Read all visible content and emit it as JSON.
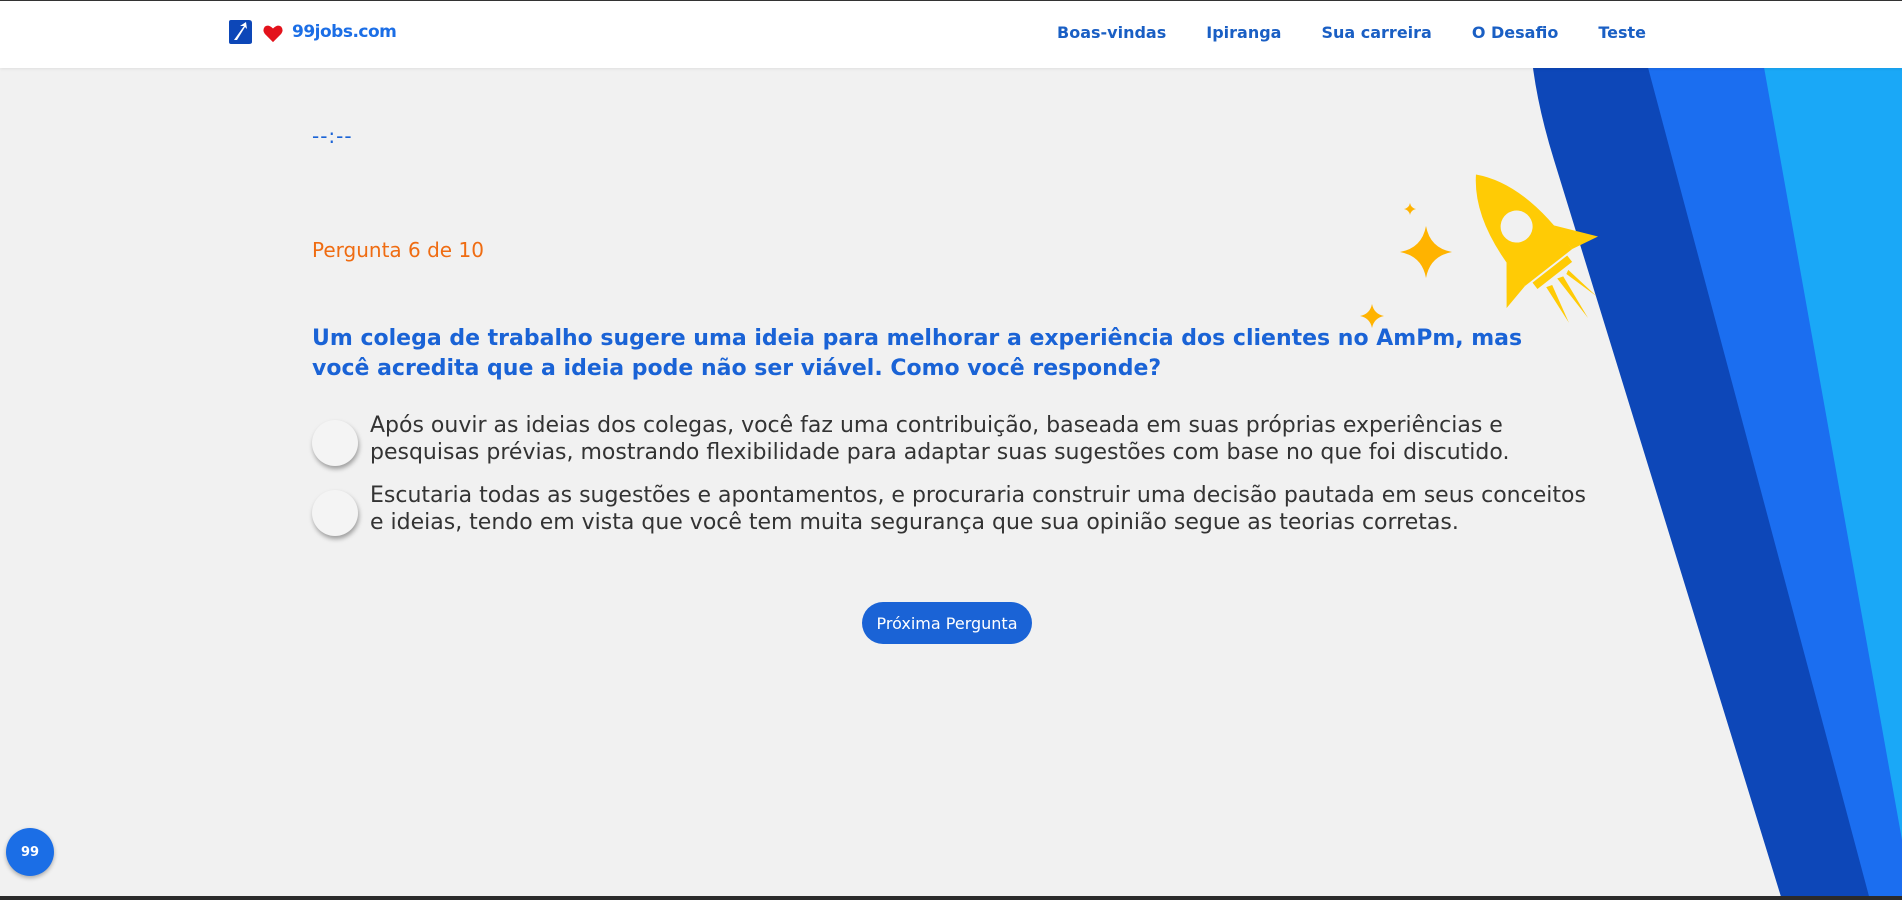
{
  "brand": {
    "logo_text": "99jobs.com"
  },
  "nav": {
    "items": [
      {
        "label": "Boas-vindas"
      },
      {
        "label": "Ipiranga"
      },
      {
        "label": "Sua carreira"
      },
      {
        "label": "O Desafio"
      },
      {
        "label": "Teste"
      }
    ]
  },
  "quiz": {
    "timer": "--:--",
    "counter": "Pergunta 6 de 10",
    "question": "Um colega de trabalho sugere uma ideia para melhorar a experiência dos clientes no AmPm, mas você acredita que a ideia pode não ser viável. Como você responde?",
    "options": [
      {
        "text": "Após ouvir as ideias dos colegas, você faz uma contribuição, baseada em suas próprias experiências e pesquisas prévias, mostrando flexibilidade para adaptar suas sugestões com base no que foi discutido."
      },
      {
        "text": "Escutaria todas as sugestões e apontamentos, e procuraria construir uma decisão pautada em seus conceitos e ideias, tendo em vista que você tem muita segurança que sua opinião segue as teorias corretas."
      }
    ],
    "next_label": "Próxima Pergunta"
  },
  "fab": {
    "label": "99"
  },
  "colors": {
    "primary": "#1a63d6",
    "accent_orange": "#ef6c12",
    "rocket_yellow": "#ffcb05",
    "stripe_dark": "#0d47b8",
    "stripe_mid": "#1b6ef0",
    "stripe_light": "#1aa8f7"
  }
}
